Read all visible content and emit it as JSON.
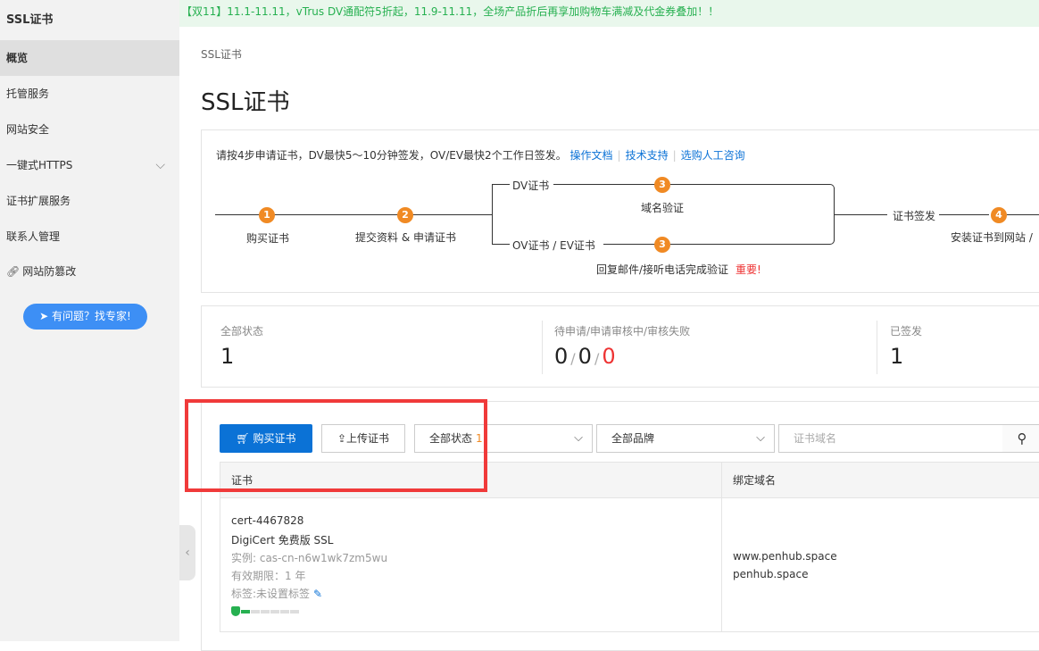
{
  "sidebar": {
    "title": "SSL证书",
    "items": [
      {
        "label": "概览",
        "active": true
      },
      {
        "label": "托管服务"
      },
      {
        "label": "网站安全"
      },
      {
        "label": "一键式HTTPS"
      },
      {
        "label": "证书扩展服务"
      },
      {
        "label": "联系人管理"
      },
      {
        "label": "网站防篡改"
      }
    ],
    "help_button": "有问题？找专家!"
  },
  "banner": {
    "text": "【双11】11.1-11.11，vTrus DV通配符5折起，11.9-11.11，全场产品折后再享加购物车满减及代金券叠加！！"
  },
  "breadcrumb": "SSL证书",
  "page_title": "SSL证书",
  "steps": {
    "intro": "请按4步申请证书，DV最快5～10分钟签发，OV/EV最快2个工作日签发。",
    "links": [
      "操作文档",
      "技术支持",
      "选购人工咨询"
    ],
    "step1_num": "1",
    "step1_label": "购买证书",
    "step2_num": "2",
    "step2_label": "提交资料 & 申请证书",
    "dv_label": "DV证书",
    "step3_num": "3",
    "dv_step3_label": "域名验证",
    "ov_label": "OV证书 / EV证书",
    "ov_step3_label": "回复邮件/接听电话完成验证",
    "ov_important": "重要!",
    "issue_label": "证书签发",
    "step4_num": "4",
    "step4_label": "安装证书到网站 /"
  },
  "stats": {
    "all_label": "全部状态",
    "all_value": "1",
    "pending_label": "待申请/申请审核中/审核失败",
    "pending_values": [
      "0",
      "0",
      "0"
    ],
    "issued_label": "已签发",
    "issued_value": "1"
  },
  "toolbar": {
    "buy_label": "购买证书",
    "upload_label": "上传证书",
    "status_select": "全部状态",
    "status_count": "1",
    "brand_select": "全部品牌",
    "search_placeholder": "证书域名"
  },
  "table": {
    "headers": [
      "证书",
      "绑定域名"
    ],
    "row": {
      "cert_id": "cert-4467828",
      "cert_name": "DigiCert 免费版 SSL",
      "instance": "实例: cas-cn-n6w1wk7zm5wu",
      "validity": "有效期限：1 年",
      "tags": "标签:未设置标签",
      "domains": [
        "www.penhub.space",
        "penhub.space"
      ]
    }
  },
  "colors": {
    "accent": "#0b72d6",
    "step_orange": "#f08a24",
    "banner_green": "#26b050",
    "highlight_red": "#f03a3a"
  }
}
